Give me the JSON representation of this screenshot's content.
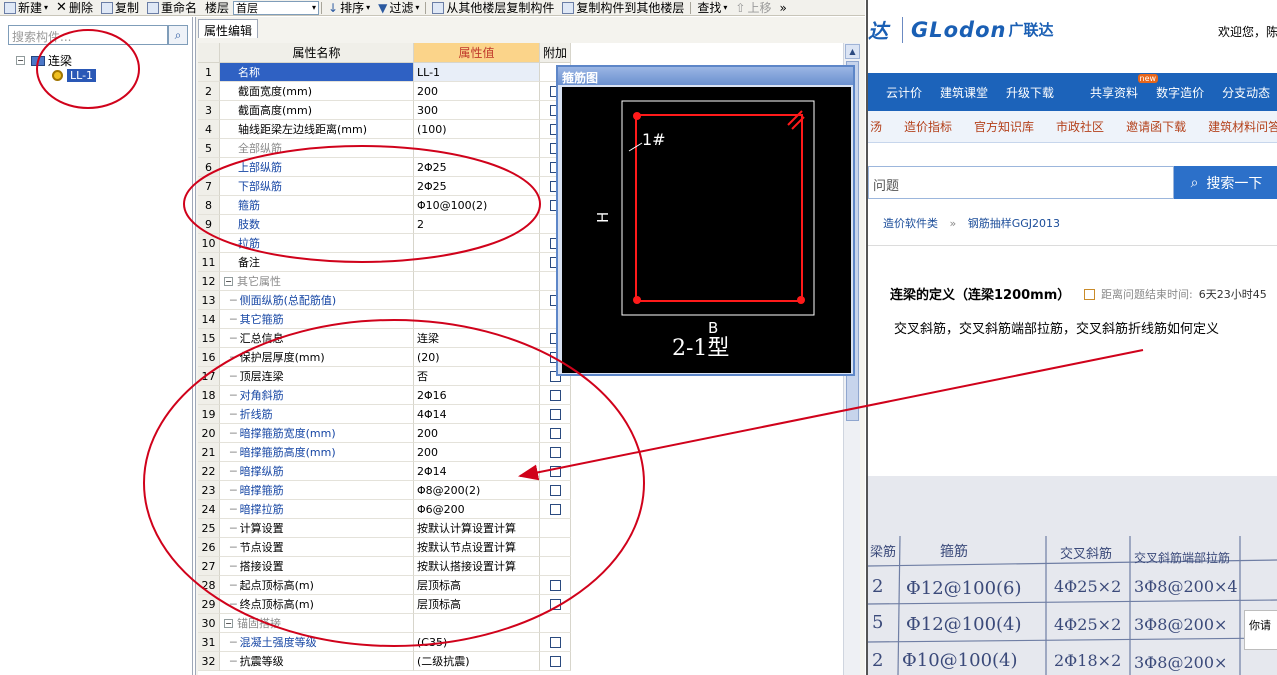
{
  "toolbar": {
    "new_label": "新建",
    "delete_label": "删除",
    "copy_label": "复制",
    "rename_label": "重命名",
    "floor_label": "楼层",
    "floor_value": "首层",
    "sort_label": "排序",
    "filter_label": "过滤",
    "copy_from_floor_label": "从其他楼层复制构件",
    "copy_to_floor_label": "复制构件到其他楼层",
    "find_label": "查找",
    "move_up_label": "上移",
    "more_label": "»"
  },
  "left_panel": {
    "search_placeholder": "搜索构件...",
    "tree_root_label": "连梁",
    "tree_root_toggle": "−",
    "tree_child_label": "LL-1"
  },
  "grid": {
    "tab_label": "属性编辑",
    "headers": {
      "name": "属性名称",
      "value": "属性值",
      "add": "附加"
    },
    "rows": [
      {
        "num": "1",
        "name": "名称",
        "value": "LL-1",
        "style": "sel",
        "checkbox": false
      },
      {
        "num": "2",
        "name": "截面宽度(mm)",
        "value": "200",
        "style": "normal",
        "checkbox": true
      },
      {
        "num": "3",
        "name": "截面高度(mm)",
        "value": "300",
        "style": "normal",
        "checkbox": true
      },
      {
        "num": "4",
        "name": "轴线距梁左边线距离(mm)",
        "value": "(100)",
        "style": "normal",
        "checkbox": true
      },
      {
        "num": "5",
        "name": "全部纵筋",
        "value": "",
        "style": "gray",
        "checkbox": true
      },
      {
        "num": "6",
        "name": "上部纵筋",
        "value": "2Φ25",
        "style": "blue",
        "checkbox": true
      },
      {
        "num": "7",
        "name": "下部纵筋",
        "value": "2Φ25",
        "style": "blue",
        "checkbox": true
      },
      {
        "num": "8",
        "name": "箍筋",
        "value": "Φ10@100(2)",
        "style": "blue",
        "checkbox": true
      },
      {
        "num": "9",
        "name": "肢数",
        "value": "2",
        "style": "blue",
        "checkbox": false
      },
      {
        "num": "10",
        "name": "拉筋",
        "value": "",
        "style": "blue",
        "checkbox": true
      },
      {
        "num": "11",
        "name": "备注",
        "value": "",
        "style": "normal",
        "checkbox": true
      },
      {
        "num": "12",
        "name": "其它属性",
        "value": "",
        "style": "group",
        "checkbox": false
      },
      {
        "num": "13",
        "name": "侧面纵筋(总配筋值)",
        "value": "",
        "style": "blue-indent",
        "checkbox": true
      },
      {
        "num": "14",
        "name": "其它箍筋",
        "value": "",
        "style": "blue-indent",
        "checkbox": false
      },
      {
        "num": "15",
        "name": "汇总信息",
        "value": "连梁",
        "style": "indent",
        "checkbox": true
      },
      {
        "num": "16",
        "name": "保护层厚度(mm)",
        "value": "(20)",
        "style": "indent",
        "checkbox": true
      },
      {
        "num": "17",
        "name": "顶层连梁",
        "value": "否",
        "style": "indent",
        "checkbox": true
      },
      {
        "num": "18",
        "name": "对角斜筋",
        "value": "2Φ16",
        "style": "blue-indent",
        "checkbox": true
      },
      {
        "num": "19",
        "name": "折线筋",
        "value": "4Φ14",
        "style": "blue-indent",
        "checkbox": true
      },
      {
        "num": "20",
        "name": "暗撑箍筋宽度(mm)",
        "value": "200",
        "style": "blue-indent",
        "checkbox": true
      },
      {
        "num": "21",
        "name": "暗撑箍筋高度(mm)",
        "value": "200",
        "style": "blue-indent",
        "checkbox": true
      },
      {
        "num": "22",
        "name": "暗撑纵筋",
        "value": "2Φ14",
        "style": "blue-indent",
        "checkbox": true
      },
      {
        "num": "23",
        "name": "暗撑箍筋",
        "value": "Φ8@200(2)",
        "style": "blue-indent",
        "checkbox": true
      },
      {
        "num": "24",
        "name": "暗撑拉筋",
        "value": "Φ6@200",
        "style": "blue-indent",
        "checkbox": true
      },
      {
        "num": "25",
        "name": "计算设置",
        "value": "按默认计算设置计算",
        "style": "indent",
        "checkbox": false
      },
      {
        "num": "26",
        "name": "节点设置",
        "value": "按默认节点设置计算",
        "style": "indent",
        "checkbox": false
      },
      {
        "num": "27",
        "name": "搭接设置",
        "value": "按默认搭接设置计算",
        "style": "indent",
        "checkbox": false
      },
      {
        "num": "28",
        "name": "起点顶标高(m)",
        "value": "层顶标高",
        "style": "indent",
        "checkbox": true
      },
      {
        "num": "29",
        "name": "终点顶标高(m)",
        "value": "层顶标高",
        "style": "indent",
        "checkbox": true
      },
      {
        "num": "30",
        "name": "锚固搭接",
        "value": "",
        "style": "group-gray",
        "checkbox": false
      },
      {
        "num": "31",
        "name": "混凝土强度等级",
        "value": "(C35)",
        "style": "blue-indent",
        "checkbox": true
      },
      {
        "num": "32",
        "name": "抗震等级",
        "value": "(二级抗震)",
        "style": "indent",
        "checkbox": true
      }
    ]
  },
  "stirrup_window": {
    "title": "箍筋图",
    "bar_label": "1#",
    "height_label": "H",
    "width_label": "B",
    "type_label": "2-1型"
  },
  "website": {
    "logo_slash": "达",
    "logo_brand": "GLodon",
    "logo_cn": "广联达",
    "welcome": "欢迎您，陈",
    "nav_main": [
      "云计价",
      "建筑课堂",
      "升级下载",
      "共享资料",
      "数字造价",
      "分支动态"
    ],
    "nav_new_badge": "new",
    "nav_secondary": [
      "汤",
      "造价指标",
      "官方知识库",
      "市政社区",
      "邀请函下载",
      "建筑材料问答"
    ],
    "search_placeholder": "问题",
    "search_button": "搜索一下",
    "breadcrumb": [
      "造价软件类",
      "钢筋抽样GGJ2013"
    ],
    "breadcrumb_sep": "»",
    "question_title": "连梁的定义（连梁1200mm）",
    "timer_label": "距离问题结束时间:",
    "timer_value": "6天23小时45",
    "question_body": "交叉斜筋，交叉斜筋端部拉筋，交叉斜筋折线筋如何定义",
    "table_headers": [
      "梁筋",
      "箍筋",
      "交叉斜筋",
      "交叉斜筋端部拉筋"
    ],
    "table_rows": [
      [
        "2",
        "Φ12@100(6)",
        "4Φ25×2",
        "3Φ8@200×4"
      ],
      [
        "5",
        "Φ12@100(4)",
        "4Φ25×2",
        "3Φ8@200×"
      ],
      [
        "2",
        "Φ10@100(4)",
        "2Φ18×2",
        "3Φ8@200×"
      ]
    ],
    "popup_text": "你请"
  },
  "colors": {
    "annotation_red": "#d0021b",
    "brand_blue": "#1c63ba",
    "selected_row": "#2f61c3",
    "header_value_bg": "#fbd48a",
    "rebar_red": "#ff1a1a"
  }
}
